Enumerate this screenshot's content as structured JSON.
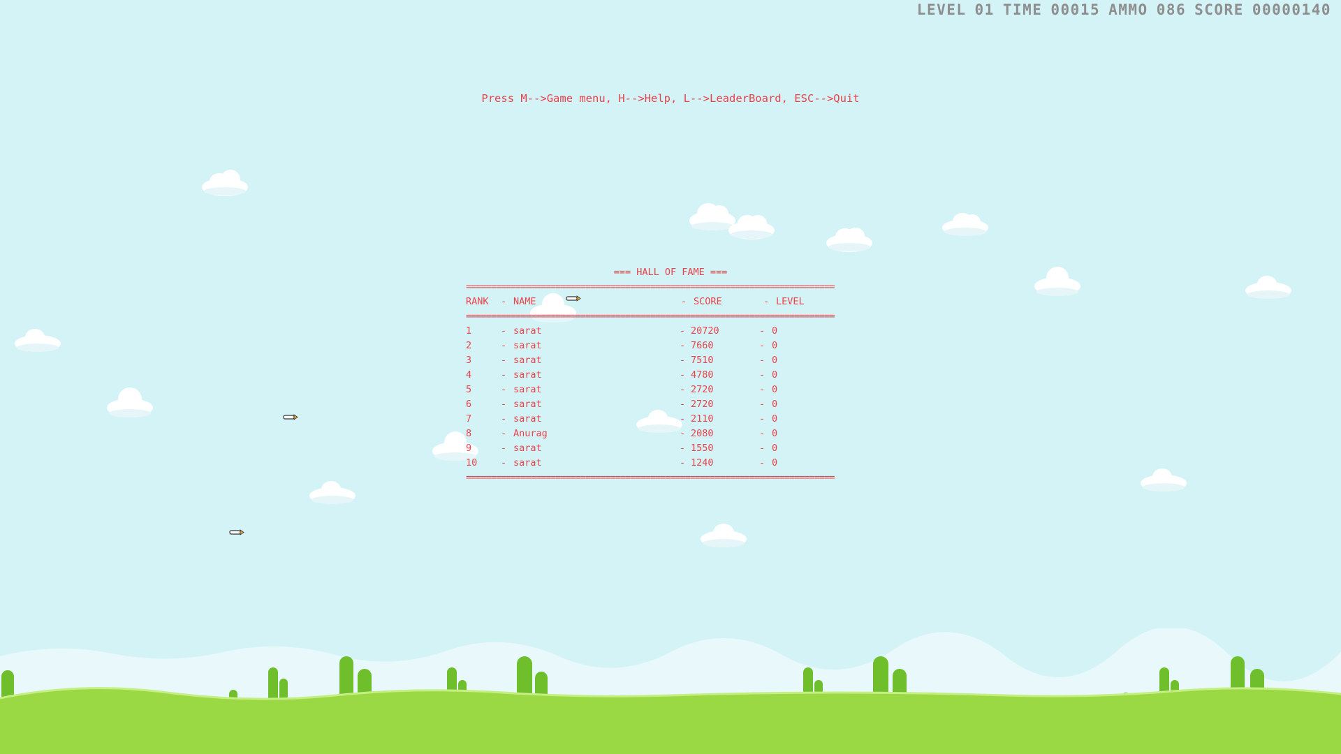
{
  "hud": {
    "level_label": "LEVEL",
    "level_value": "01",
    "time_label": "TIME",
    "time_value": "00015",
    "ammo_label": "AMMO",
    "ammo_value": "086",
    "score_label": "SCORE",
    "score_value": "00000140"
  },
  "hint": "Press M-->Game menu, H-->Help, L-->LeaderBoard, ESC-->Quit",
  "hall_of_fame": {
    "title": "=== HALL OF FAME ===",
    "rule": "==========================================================================",
    "headers": {
      "rank": "RANK",
      "name": "NAME",
      "score": "SCORE",
      "level": "LEVEL",
      "sep": "-"
    },
    "rows": [
      {
        "rank": "1",
        "name": "sarat",
        "score": "20720",
        "level": "0"
      },
      {
        "rank": "2",
        "name": "sarat",
        "score": "7660",
        "level": "0"
      },
      {
        "rank": "3",
        "name": "sarat",
        "score": "7510",
        "level": "0"
      },
      {
        "rank": "4",
        "name": "sarat",
        "score": "4780",
        "level": "0"
      },
      {
        "rank": "5",
        "name": "sarat",
        "score": "2720",
        "level": "0"
      },
      {
        "rank": "6",
        "name": "sarat",
        "score": "2720",
        "level": "0"
      },
      {
        "rank": "7",
        "name": "sarat",
        "score": "2110",
        "level": "0"
      },
      {
        "rank": "8",
        "name": "Anurag",
        "score": "2080",
        "level": "0"
      },
      {
        "rank": "9",
        "name": "sarat",
        "score": "1550",
        "level": "0"
      },
      {
        "rank": "10",
        "name": "sarat",
        "score": "1240",
        "level": "0"
      }
    ]
  },
  "colors": {
    "sky": "#d3f3f6",
    "text_red": "#e8434a",
    "hud_gray": "#8e8e8e",
    "grass": "#9bd944",
    "cactus": "#6fbf2c",
    "cloud": "#ffffff"
  },
  "sprites": {
    "cloud": "cloud-sprite",
    "bullet": "bullet-sprite",
    "cactus": "cactus-sprite"
  }
}
